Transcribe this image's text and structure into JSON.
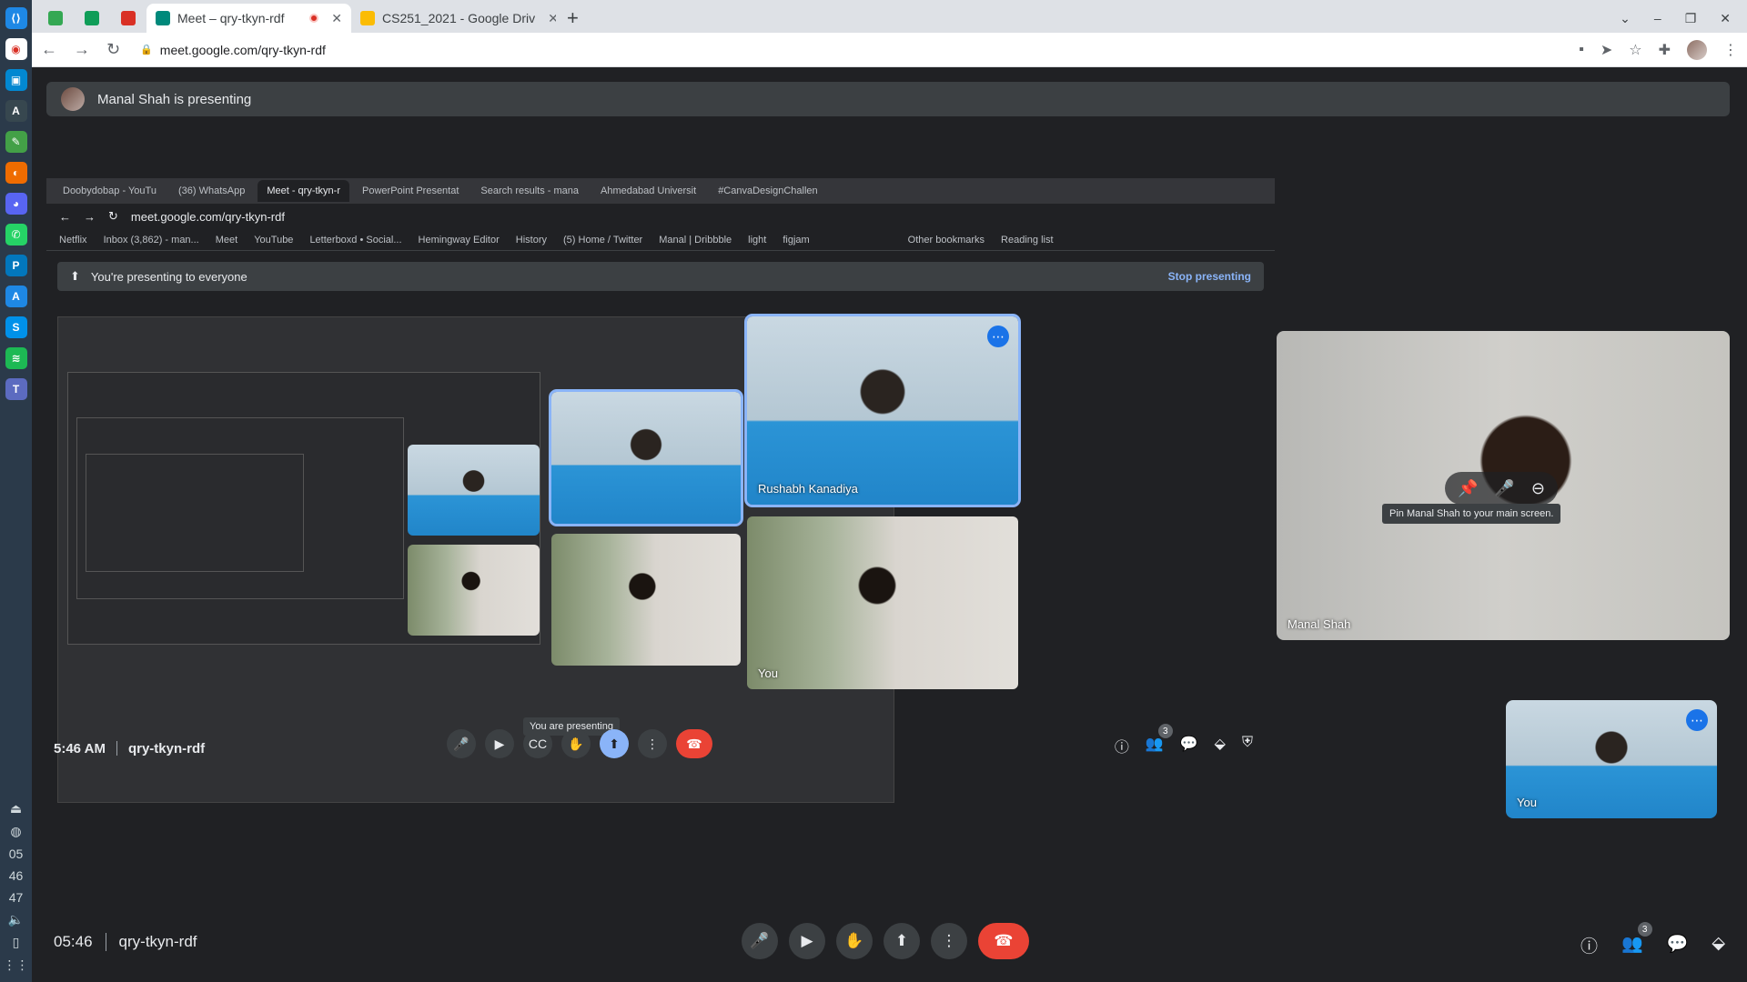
{
  "tabs": [
    {
      "label": "",
      "pinned": true,
      "favicon_color": "#34a853"
    },
    {
      "label": "",
      "pinned": true,
      "favicon_color": "#0f9d58"
    },
    {
      "label": "",
      "pinned": true,
      "favicon_color": "#d93025"
    },
    {
      "label": "Meet – qry-tkyn-rdf",
      "active": true,
      "recording": true,
      "favicon_color": "#00897b"
    },
    {
      "label": "CS251_2021 - Google Driv",
      "favicon_color": "#fbbc04"
    }
  ],
  "address": {
    "url": "meet.google.com/qry-tkyn-rdf"
  },
  "banner": {
    "text": "Manal Shah is presenting"
  },
  "shared": {
    "tabs": [
      "Doobydobap - YouTu",
      "(36) WhatsApp",
      "Meet - qry-tkyn-r",
      "PowerPoint Presentat",
      "Search results - mana",
      "Ahmedabad Universit",
      "#CanvaDesignChallen"
    ],
    "url": "meet.google.com/qry-tkyn-rdf",
    "bookmarks": [
      "Netflix",
      "Inbox (3,862) - man...",
      "Meet",
      "YouTube",
      "Letterboxd • Social...",
      "Hemingway Editor",
      "History",
      "(5) Home / Twitter",
      "Manal | Dribbble",
      "light",
      "figjam",
      "Other bookmarks",
      "Reading list"
    ],
    "banner_text": "You're presenting to everyone",
    "stop_label": "Stop presenting",
    "tile_rushabh": "Rushabh Kanadiya",
    "tile_you": "You",
    "time": "5:46 AM",
    "code": "qry-tkyn-rdf",
    "tooltip": "You are presenting",
    "participants_badge": "3"
  },
  "tiles": {
    "manal": "Manal Shah",
    "self": "You",
    "pin_tooltip": "Pin Manal Shah to your main screen."
  },
  "bottom": {
    "time": "05:46",
    "code": "qry-tkyn-rdf",
    "participants_badge": "3"
  },
  "dock": {
    "numbers": [
      "05",
      "46",
      "47"
    ]
  },
  "colors": {
    "accent": "#8ab4f8",
    "end_call": "#ea4335",
    "bg": "#202124"
  }
}
